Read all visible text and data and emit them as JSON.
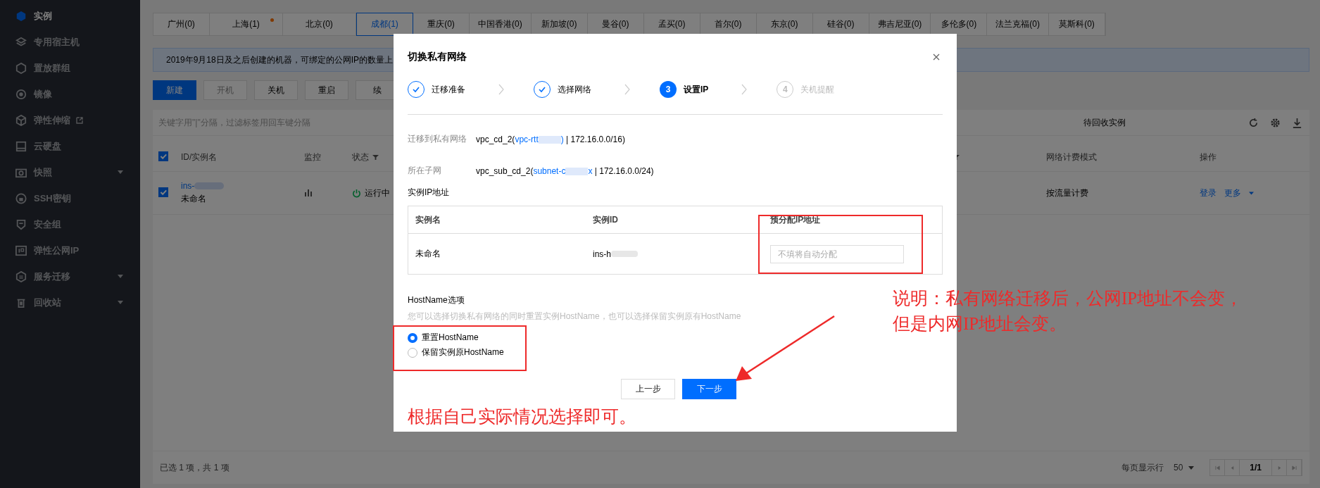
{
  "sidebar": {
    "items": [
      {
        "label": "实例",
        "selected": true,
        "kind": "link"
      },
      {
        "label": "专用宿主机",
        "selected": false,
        "kind": "link"
      },
      {
        "label": "置放群组",
        "selected": false,
        "kind": "link"
      },
      {
        "label": "镜像",
        "selected": false,
        "kind": "link"
      },
      {
        "label": "弹性伸缩",
        "selected": false,
        "kind": "external"
      },
      {
        "label": "云硬盘",
        "selected": false,
        "kind": "link"
      },
      {
        "label": "快照",
        "selected": false,
        "kind": "group"
      },
      {
        "label": "SSH密钥",
        "selected": false,
        "kind": "link"
      },
      {
        "label": "安全组",
        "selected": false,
        "kind": "link"
      },
      {
        "label": "弹性公网IP",
        "selected": false,
        "kind": "link"
      },
      {
        "label": "服务迁移",
        "selected": false,
        "kind": "group"
      },
      {
        "label": "回收站",
        "selected": false,
        "kind": "group"
      }
    ]
  },
  "region_tabs": [
    {
      "label": "广州(0)",
      "selected": false,
      "dot": false
    },
    {
      "label": "上海(1)",
      "selected": false,
      "dot": true
    },
    {
      "label": "北京(0)",
      "selected": false,
      "dot": false
    },
    {
      "label": "成都(1)",
      "selected": true,
      "dot": false
    },
    {
      "label": "重庆(0)",
      "selected": false,
      "dot": false
    },
    {
      "label": "中国香港(0)",
      "selected": false,
      "dot": false
    },
    {
      "label": "新加坡(0)",
      "selected": false,
      "dot": false
    },
    {
      "label": "曼谷(0)",
      "selected": false,
      "dot": false
    },
    {
      "label": "孟买(0)",
      "selected": false,
      "dot": false
    },
    {
      "label": "首尔(0)",
      "selected": false,
      "dot": false
    },
    {
      "label": "东京(0)",
      "selected": false,
      "dot": false
    },
    {
      "label": "硅谷(0)",
      "selected": false,
      "dot": false
    },
    {
      "label": "弗吉尼亚(0)",
      "selected": false,
      "dot": false
    },
    {
      "label": "多伦多(0)",
      "selected": false,
      "dot": false
    },
    {
      "label": "法兰克福(0)",
      "selected": false,
      "dot": false
    },
    {
      "label": "莫斯科(0)",
      "selected": false,
      "dot": false
    }
  ],
  "notice": "2019年9月18日及之后创建的机器，可绑定的公网IP的数量上",
  "toolbar": [
    {
      "label": "新建",
      "kind": "primary"
    },
    {
      "label": "开机",
      "kind": "disabled"
    },
    {
      "label": "关机",
      "kind": "default"
    },
    {
      "label": "重启",
      "kind": "default"
    },
    {
      "label": "续",
      "kind": "default"
    }
  ],
  "search": {
    "placeholder": "关键字用\"|\"分隔，过滤标签用回车键分隔"
  },
  "recycle_link": "待回收实例",
  "table": {
    "header_checked": true,
    "columns": [
      "ID/实例名",
      "监控",
      "状态",
      "网络计费模式",
      "操作"
    ],
    "rows": [
      {
        "checked": true,
        "id": "ins-",
        "name": "未命名",
        "status": "运行中",
        "billing": "按流量计费",
        "actions": [
          "登录",
          "更多"
        ]
      }
    ]
  },
  "footer": {
    "selection": "已选 1 项，共 1 项",
    "page_size_label": "每页显示行",
    "page_size": "50",
    "page": "1/1"
  },
  "dialog": {
    "title": "切换私有网络",
    "steps": [
      {
        "label": "迁移准备",
        "completed": true,
        "current": false
      },
      {
        "label": "选择网络",
        "completed": true,
        "current": false
      },
      {
        "label": "设置IP",
        "completed": false,
        "current": true,
        "number": "3"
      },
      {
        "label": "关机提醒",
        "completed": false,
        "current": false,
        "number": "4"
      }
    ],
    "fields": [
      {
        "label": "迁移到私有网络",
        "value": "vpc_cd_2(",
        "link": "vpc-rtt",
        "link_tail": ")",
        "suffix": " | 172.16.0.0/16)"
      },
      {
        "label": "所在子网",
        "value": "vpc_sub_cd_2(",
        "link": "subnet-c",
        "link_tail": "x",
        "suffix": " | 172.16.0.0/24)"
      }
    ],
    "ip_section": "实例IP地址",
    "ip_table": {
      "columns": [
        "实例名",
        "实例ID",
        "预分配IP地址"
      ],
      "rows": [
        {
          "name": "未命名",
          "id": "ins-h",
          "ip_placeholder": "不填将自动分配"
        }
      ]
    },
    "hostname": {
      "title": "HostName选项",
      "description": "您可以选择切换私有网络的同时重置实例HostName，也可以选择保留实例原有HostName",
      "options": [
        {
          "label": "重置HostName",
          "selected": true
        },
        {
          "label": "保留实例原HostName",
          "selected": false
        }
      ]
    },
    "buttons": [
      {
        "label": "上一步",
        "kind": "default"
      },
      {
        "label": "下一步",
        "kind": "primary"
      }
    ]
  },
  "annotations": {
    "note_lines": [
      "说明：私有网络迁移后，公网IP地址不会变，",
      "但是内网IP地址会变。"
    ],
    "hint": "根据自己实际情况选择即可。"
  }
}
